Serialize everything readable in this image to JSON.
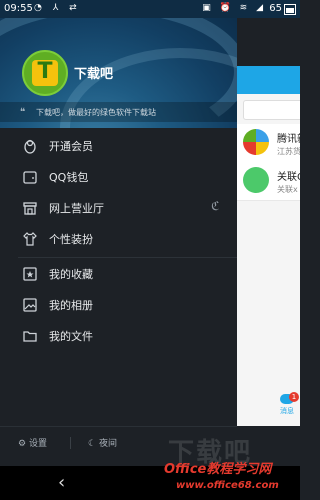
{
  "status_bar": {
    "time": "09:55",
    "battery": "65"
  },
  "profile": {
    "nickname": "下载吧",
    "signature": "下载吧，做最好的绿色软件下载站"
  },
  "menu": {
    "items": [
      {
        "label": "开通会员"
      },
      {
        "label": "QQ钱包"
      },
      {
        "label": "网上营业厅"
      },
      {
        "label": "个性装扮"
      },
      {
        "label": "我的收藏"
      },
      {
        "label": "我的相册"
      },
      {
        "label": "我的文件"
      }
    ]
  },
  "bottom": {
    "settings": "设置",
    "night_mode": "夜间"
  },
  "peek_panel": {
    "chats": [
      {
        "title": "腾讯新",
        "subtitle": "江苏货"
      },
      {
        "title": "关联Q",
        "subtitle": "关联x"
      }
    ],
    "message_tab": "消息",
    "badge": "1"
  },
  "watermarks": {
    "big": "下载吧",
    "line1": "Office教程学习网",
    "line2": "www.office68.com"
  },
  "colors": {
    "accent": "#1ea6e6",
    "drawer_bg": "#1d2126",
    "badge": "#e53a2e"
  }
}
